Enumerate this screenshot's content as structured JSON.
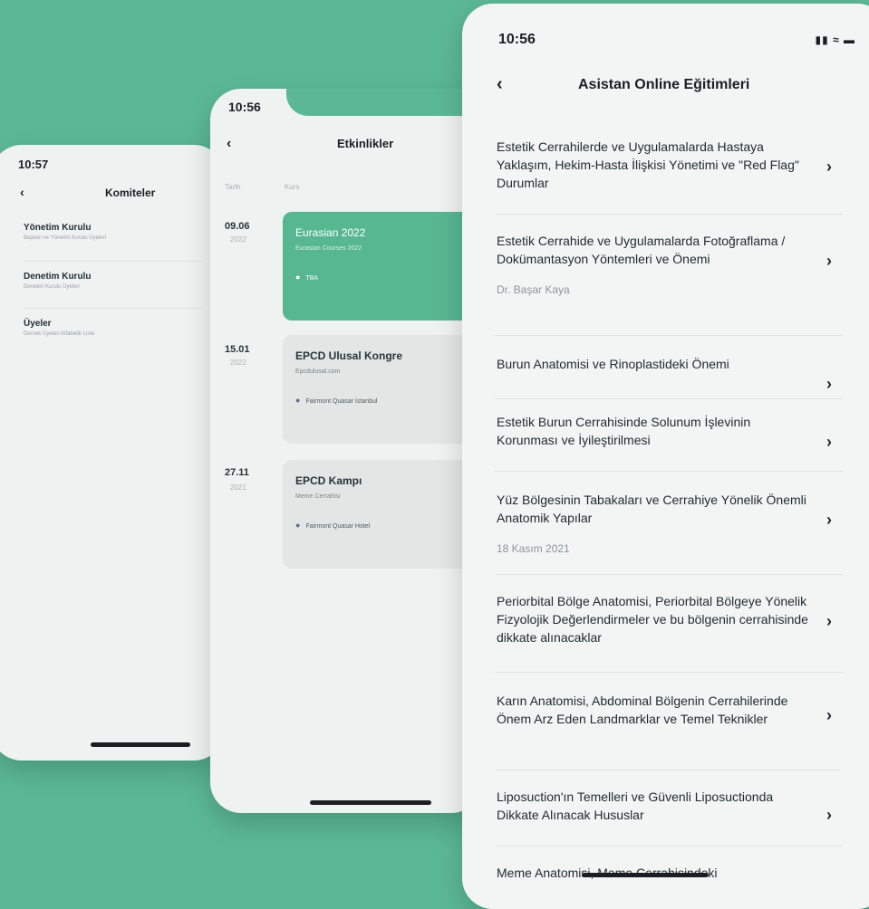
{
  "phone1": {
    "time": "10:57",
    "title": "Komiteler",
    "items": [
      {
        "name": "Yönetim Kurulu",
        "desc": "Başkan ve Yönetim Kurulu Üyeleri"
      },
      {
        "name": "Denetim Kurulu",
        "desc": "Denetim Kurulu Üyeleri"
      },
      {
        "name": "Üyeler",
        "desc": "Dernek Üyeleri Alfabetik Liste"
      }
    ]
  },
  "phone2": {
    "time": "10:56",
    "title": "Etkinlikler",
    "col_date": "Tarih",
    "col_course": "Kurs",
    "events": [
      {
        "date": "09.06",
        "year": "2022",
        "title": "Eurasian 2022",
        "subtitle": "Eurasian Courses 2022",
        "location": "TBA",
        "active": true
      },
      {
        "date": "15.01",
        "year": "2022",
        "title": "EPCD Ulusal Kongre",
        "subtitle": "Epcdulusal.com",
        "location": "Fairmont Quasar İstanbul",
        "active": false
      },
      {
        "date": "27.11",
        "year": "2021",
        "title": "EPCD Kampı",
        "subtitle": "Meme Cerrahisi",
        "location": "Fairmont Quasar Hotel",
        "active": false
      }
    ]
  },
  "phone3": {
    "time": "10:56",
    "status_icons": "signal wifi battery",
    "title": "Asistan Online Eğitimleri",
    "items": [
      {
        "text": "Estetik Cerrahilerde ve Uygulamalarda Hastaya Yaklaşım, Hekim-Hasta İlişkisi Yönetimi ve \"Red Flag\" Durumlar",
        "sub": ""
      },
      {
        "text": "Estetik Cerrahide ve Uygulamalarda Fotoğraflama / Dokümantasyon Yöntemleri ve Önemi",
        "sub": "Dr. Başar Kaya"
      },
      {
        "text": "Burun Anatomisi ve Rinoplastideki Önemi",
        "sub": ""
      },
      {
        "text": "Estetik Burun Cerrahisinde Solunum İşlevinin Korunması ve İyileştirilmesi",
        "sub": ""
      },
      {
        "text": "Yüz Bölgesinin Tabakaları ve Cerrahiye Yönelik Önemli Anatomik Yapılar",
        "sub": "18 Kasım 2021"
      },
      {
        "text": "Periorbital Bölge Anatomisi, Periorbital Bölgeye Yönelik Fizyolojik Değerlendirmeler ve bu bölgenin cerrahisinde dikkate alınacaklar",
        "sub": ""
      },
      {
        "text": "Karın Anatomisi, Abdominal Bölgenin Cerrahilerinde Önem Arz Eden Landmarklar ve Temel Teknikler",
        "sub": ""
      },
      {
        "text": "Liposuction'ın Temelleri ve Güvenli Liposuctionda Dikkate Alınacak Hususlar",
        "sub": ""
      },
      {
        "text": "Meme Anatomisi, Meme Cerrahisindeki",
        "sub": ""
      }
    ]
  },
  "colors": {
    "background": "#5bb896",
    "accent": "#57b791",
    "card": "#e2e7e5",
    "phone": "#eef2f1"
  }
}
